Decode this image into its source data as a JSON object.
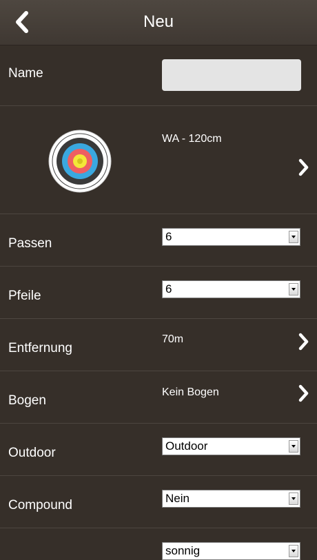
{
  "header": {
    "title": "Neu",
    "back_icon": "chevron-left-icon"
  },
  "name_row": {
    "label": "Name",
    "value": "",
    "placeholder": ""
  },
  "target_row": {
    "value": "WA - 120cm",
    "icon": "archery-target-icon"
  },
  "passen_row": {
    "label": "Passen",
    "selected": "6"
  },
  "pfeile_row": {
    "label": "Pfeile",
    "selected": "6"
  },
  "entfernung_row": {
    "label": "Entfernung",
    "value": "70m"
  },
  "bogen_row": {
    "label": "Bogen",
    "value": "Kein Bogen"
  },
  "outdoor_row": {
    "label": "Outdoor",
    "selected": "Outdoor"
  },
  "compound_row": {
    "label": "Compound",
    "selected": "Nein"
  },
  "weather_row": {
    "label": "",
    "selected": "sonnig"
  },
  "colors": {
    "background": "#362f29",
    "header": "#4e4740",
    "divider": "#4d4640",
    "text": "#ffffff"
  }
}
